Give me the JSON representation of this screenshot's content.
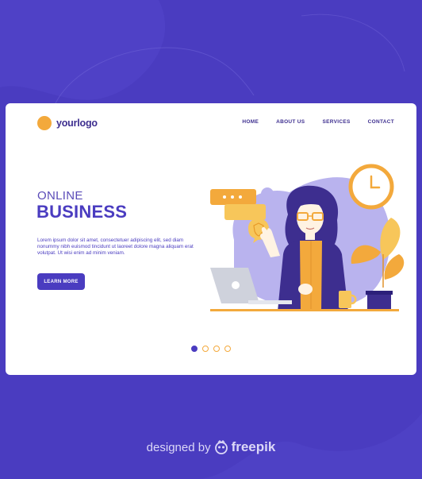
{
  "brand": {
    "logo_text": "yourlogo"
  },
  "nav": {
    "items": [
      "HOME",
      "ABOUT US",
      "SERVICES",
      "CONTACT"
    ]
  },
  "hero": {
    "title_line1": "ONLINE",
    "title_line2": "BUSINESS",
    "body": "Lorem ipsum dolor sit amet, consectetuer adipiscing elit, sed diam nonummy nibh euismod tincidunt ut laoreet dolore magna aliquam erat volutpat. Ut wisi enim ad minim veniam.",
    "cta_label": "LEARN MORE"
  },
  "carousel": {
    "count": 4,
    "active_index": 0
  },
  "footer": {
    "designed_by": "designed by",
    "brand": "freepik"
  },
  "colors": {
    "primary": "#4a3cc0",
    "accent": "#f3a93c",
    "card": "#ffffff"
  }
}
